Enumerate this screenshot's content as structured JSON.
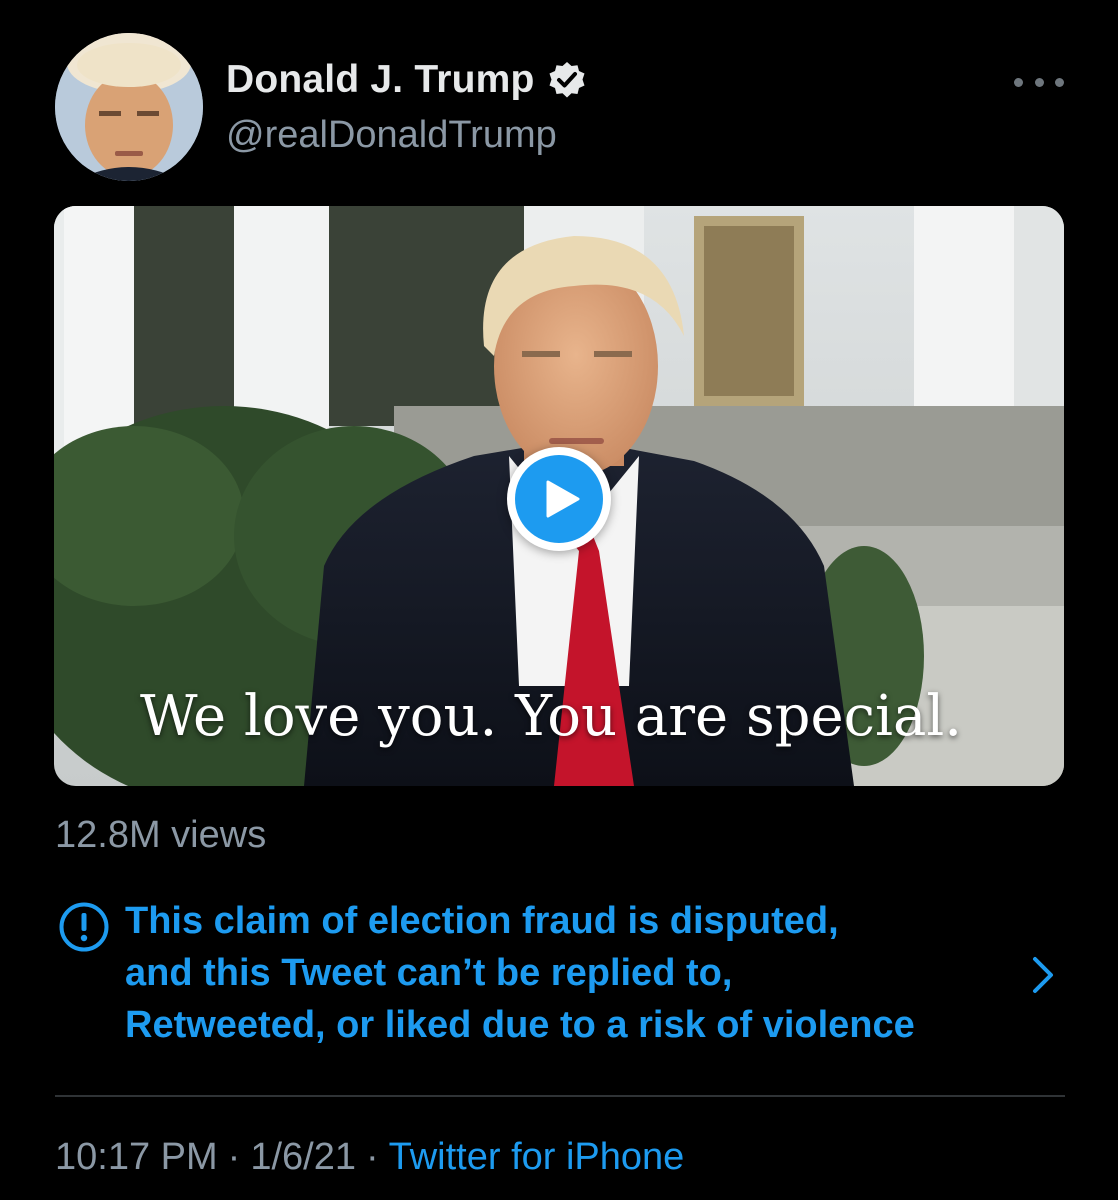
{
  "author": {
    "display_name": "Donald J. Trump",
    "handle": "@realDonaldTrump",
    "verified": true,
    "verified_icon": "verified-badge-icon"
  },
  "actions": {
    "more_icon": "more-horizontal-icon"
  },
  "media": {
    "type": "video",
    "caption": "We love you. You are special.",
    "play_icon": "play-icon",
    "views": "12.8M views"
  },
  "notice": {
    "icon": "exclamation-circle-icon",
    "lines": [
      "This claim of election fraud is disputed,",
      "and this Tweet can’t be replied to,",
      "Retweeted, or liked due to a risk of violence"
    ],
    "chevron_icon": "chevron-right-icon"
  },
  "meta": {
    "time": "10:17 PM",
    "separator": "·",
    "date": "1/6/21",
    "source": "Twitter for iPhone"
  },
  "colors": {
    "background": "#000000",
    "accent": "#1d9bf0",
    "secondary_text": "#8b98a5",
    "primary_text": "#e7e9ea"
  }
}
